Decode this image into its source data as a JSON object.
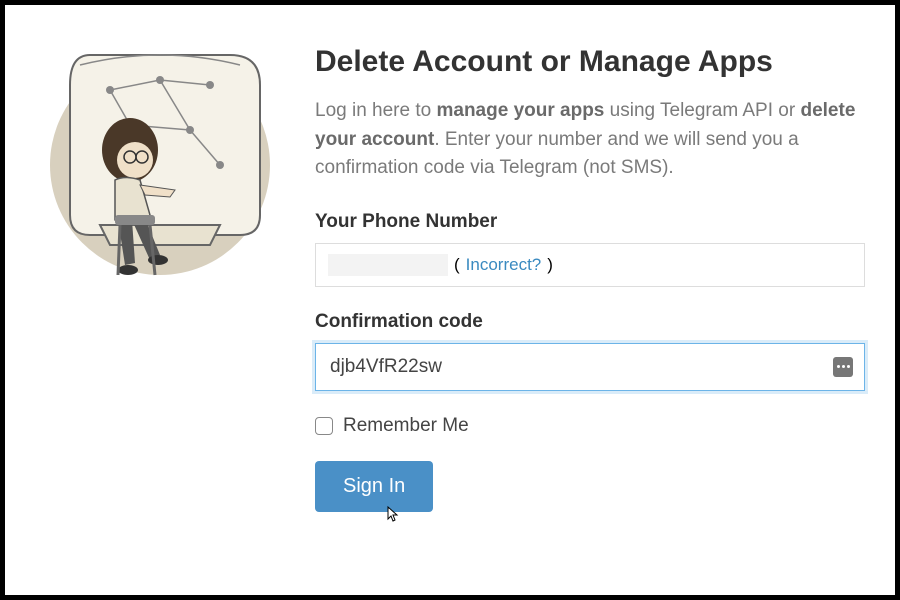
{
  "heading": "Delete Account or Manage Apps",
  "description": {
    "part1": "Log in here to ",
    "bold1": "manage your apps",
    "part2": " using Telegram API or ",
    "bold2": "delete your account",
    "part3": ". Enter your number and we will send you a confirmation code via Telegram (not SMS)."
  },
  "phone": {
    "label": "Your Phone Number",
    "incorrect_open": "(",
    "incorrect_text": "Incorrect?",
    "incorrect_close": ")"
  },
  "code": {
    "label": "Confirmation code",
    "value": "djb4VfR22sw"
  },
  "remember": {
    "label": "Remember Me"
  },
  "signin": {
    "label": "Sign In"
  }
}
